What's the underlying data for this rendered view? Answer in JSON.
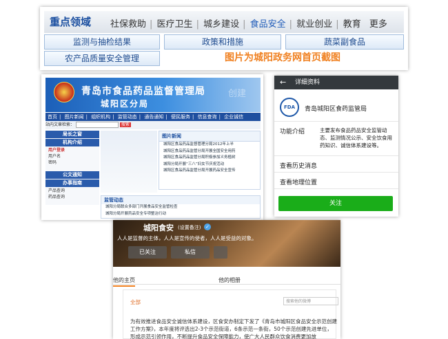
{
  "top": {
    "title": "重点领域",
    "categories": [
      "社保救助",
      "医疗卫生",
      "城乡建设",
      "食品安全",
      "就业创业",
      "教育",
      "更多"
    ],
    "active_category": "食品安全",
    "buttons": [
      "监测与抽检结果",
      "政策和措施",
      "蔬菜副食品",
      "农产品质量安全管理"
    ],
    "caption": "图片为城阳政务网首页截图"
  },
  "site": {
    "title": "青岛市食品药品监督管理局",
    "subtitle": "城阳区分局",
    "watermark": "创建",
    "nav": [
      "首页",
      "图片新闻",
      "组织机构",
      "监管动态",
      "通告通知",
      "便民服务",
      "信息查询",
      "企业诚信"
    ],
    "search_label": "站内文章检索：",
    "search_button": "搜索",
    "menu": [
      "局长之窗",
      "机构介绍",
      "公文通知",
      "办事指南"
    ],
    "login_label": "用户登录",
    "user_label": "用户名",
    "password_label": "密码",
    "product_label": "产品查询",
    "drug_label": "药品查询",
    "news_head": "图片新闻",
    "news_items": [
      "城阳区食品药品监督管理分局2012年上半",
      "城阳区食品药品监管分局开展全国安全用药",
      "城阳区食品药品监管分局积极参加义务植树",
      "城阳分局开展“三八”妇女节庆祝活动",
      "城阳区食品药品监管分局开展药品安全宣传"
    ],
    "supervise_head": "监管动态",
    "supervise_items": [
      "城阳分局联合多部门开展食品安全监管检查",
      "城阳分局开展药品安全专项整治行动"
    ]
  },
  "wx": {
    "bar_title": "详细资料",
    "name": "青岛城阳区食药监管局",
    "logo_text": "FDA",
    "intro_label": "功能介绍",
    "intro": "主要发布食品药品安全监管动态、监测情况公示、安全饮食用药知识、诚信体系建设等。",
    "history": "查看历史消息",
    "location": "查看地理位置",
    "follow": "关注"
  },
  "wb": {
    "name": "城阳食安",
    "auth": "(设置备注)",
    "verified_mark": "✓",
    "slogan": "人人是监督的主体，人人是宣传的使者，人人是受益的对象。",
    "btn_followed": "已关注",
    "btn_message": "私信",
    "btn_more": "",
    "tab_home": "他的主页",
    "tab_album": "他的相册",
    "feed_all": "全部",
    "search_placeholder": "搜索他的微博",
    "post": "为有效推进食品安全诚信体系建设，区食安办制定下发了《青岛市城阳区食品安全示范创建工作方案》，本年度将评选出2-3个示范街道，6条示范一条街，50个示范创建先进单位，形成示范引领作用，不断提升食品安全保障能力，使广大人民群众饮食消费更加放"
  },
  "colors": {
    "accent_blue": "#1b4fa0",
    "caption_orange": "#f08020",
    "wechat_green": "#1aad19",
    "wechat_bar": "#34393d"
  }
}
